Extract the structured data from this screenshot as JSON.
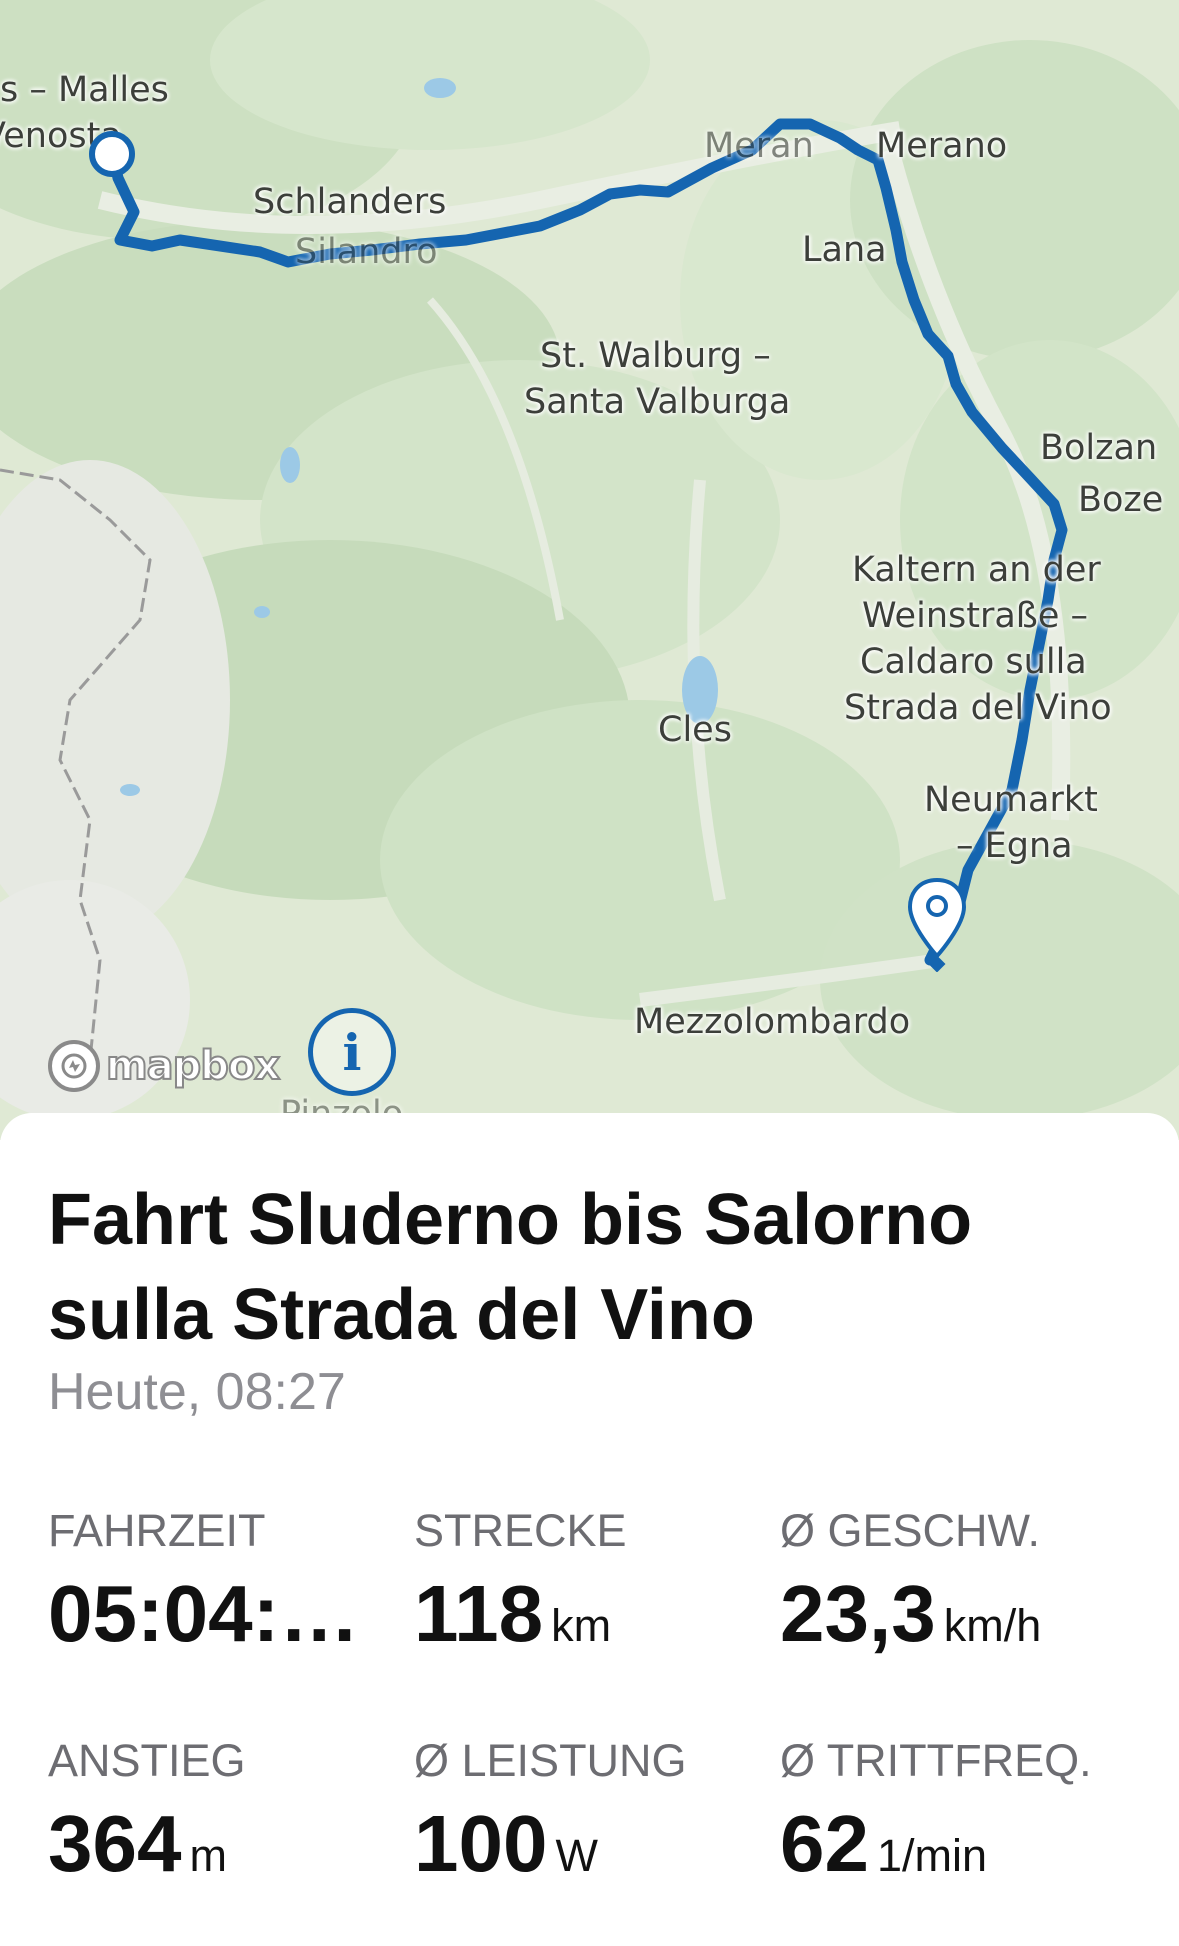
{
  "map": {
    "places": [
      {
        "id": "malles",
        "text": "s – Malles"
      },
      {
        "id": "venosta",
        "text": "Venosta"
      },
      {
        "id": "schlanders",
        "text": "Schlanders"
      },
      {
        "id": "silandro",
        "text": "Silandro"
      },
      {
        "id": "merano-it",
        "text": "Meran"
      },
      {
        "id": "merano",
        "text": "Merano"
      },
      {
        "id": "lana",
        "text": "Lana"
      },
      {
        "id": "st-walburg",
        "text": "St. Walburg –"
      },
      {
        "id": "santa-valburga",
        "text": "Santa Valburga"
      },
      {
        "id": "bolzano",
        "text": "Bolzan"
      },
      {
        "id": "bozen",
        "text": "Boze"
      },
      {
        "id": "kaltern1",
        "text": "Kaltern an der"
      },
      {
        "id": "kaltern2",
        "text": "Weinstraße –"
      },
      {
        "id": "kaltern3",
        "text": "Caldaro sulla"
      },
      {
        "id": "kaltern4",
        "text": "Strada del Vino"
      },
      {
        "id": "cles",
        "text": "Cles"
      },
      {
        "id": "neumarkt",
        "text": "Neumarkt"
      },
      {
        "id": "egna",
        "text": "– Egna"
      },
      {
        "id": "mezzolombardo",
        "text": "Mezzolombardo"
      },
      {
        "id": "pinzolo",
        "text": "Pinzolo"
      }
    ],
    "attribution": "mapbox",
    "route_color": "#1565b0",
    "icons": {
      "start": "start-dot-icon",
      "end": "end-pin-icon",
      "info": "info-icon",
      "logo": "mapbox-logo-icon"
    }
  },
  "activity": {
    "title": "Fahrt Sluderno bis Salorno sulla Strada del Vino",
    "datetime": "Heute, 08:27"
  },
  "stats": [
    {
      "label": "FAHRZEIT",
      "value": "05:04:…",
      "unit": ""
    },
    {
      "label": "STRECKE",
      "value": "118",
      "unit": "km"
    },
    {
      "label": "Ø GESCHW.",
      "value": "23,3",
      "unit": "km/h"
    },
    {
      "label": "ANSTIEG",
      "value": "364",
      "unit": "m"
    },
    {
      "label": "Ø LEISTUNG",
      "value": "100",
      "unit": "W"
    },
    {
      "label": "Ø TRITTFREQ.",
      "value": "62",
      "unit": "1/min"
    }
  ]
}
